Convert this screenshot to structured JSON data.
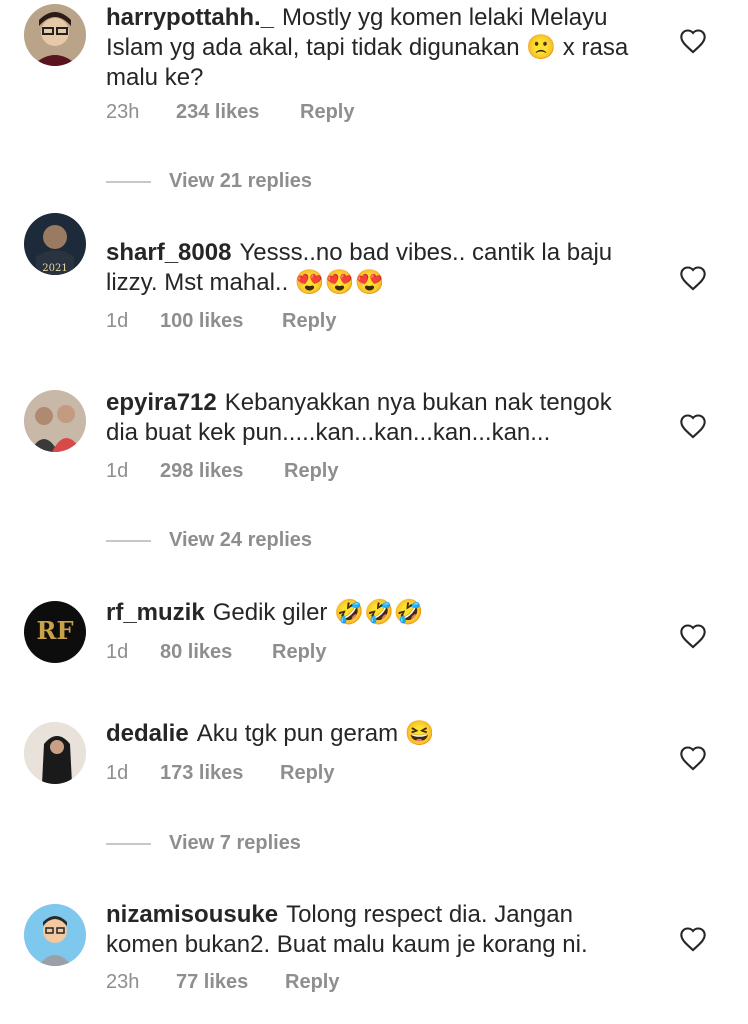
{
  "comments": [
    {
      "username": "harrypottahh._",
      "text": "Mostly yg komen lelaki Melayu Islam yg ada akal, tapi tidak digunakan 🙁 x rasa malu ke?",
      "time": "23h",
      "likes": "234 likes",
      "reply": "Reply"
    },
    {
      "username": "sharf_8008",
      "text": "Yesss..no bad vibes.. cantik la baju lizzy. Mst mahal.. 😍😍😍",
      "time": "1d",
      "likes": "100 likes",
      "reply": "Reply"
    },
    {
      "username": "epyira712",
      "text": "Kebanyakkan nya bukan nak tengok dia buat kek pun.....kan...kan...kan...kan...",
      "time": "1d",
      "likes": "298 likes",
      "reply": "Reply"
    },
    {
      "username": "rf_muzik",
      "text": "Gedik giler 🤣🤣🤣",
      "time": "1d",
      "likes": "80 likes",
      "reply": "Reply"
    },
    {
      "username": "dedalie",
      "text": "Aku tgk pun geram 😆",
      "time": "1d",
      "likes": "173 likes",
      "reply": "Reply"
    },
    {
      "username": "nizamisousuke",
      "text": "Tolong respect dia. Jangan komen bukan2. Buat malu kaum je korang ni.",
      "time": "23h",
      "likes": "77 likes",
      "reply": "Reply"
    }
  ],
  "view_replies": [
    "View 21 replies",
    "View 24 replies",
    "View 7 replies"
  ],
  "avatar_logo_text": "RF",
  "colors": {
    "text": "#262626",
    "meta": "#8e8e8e",
    "heart": "#262626"
  }
}
